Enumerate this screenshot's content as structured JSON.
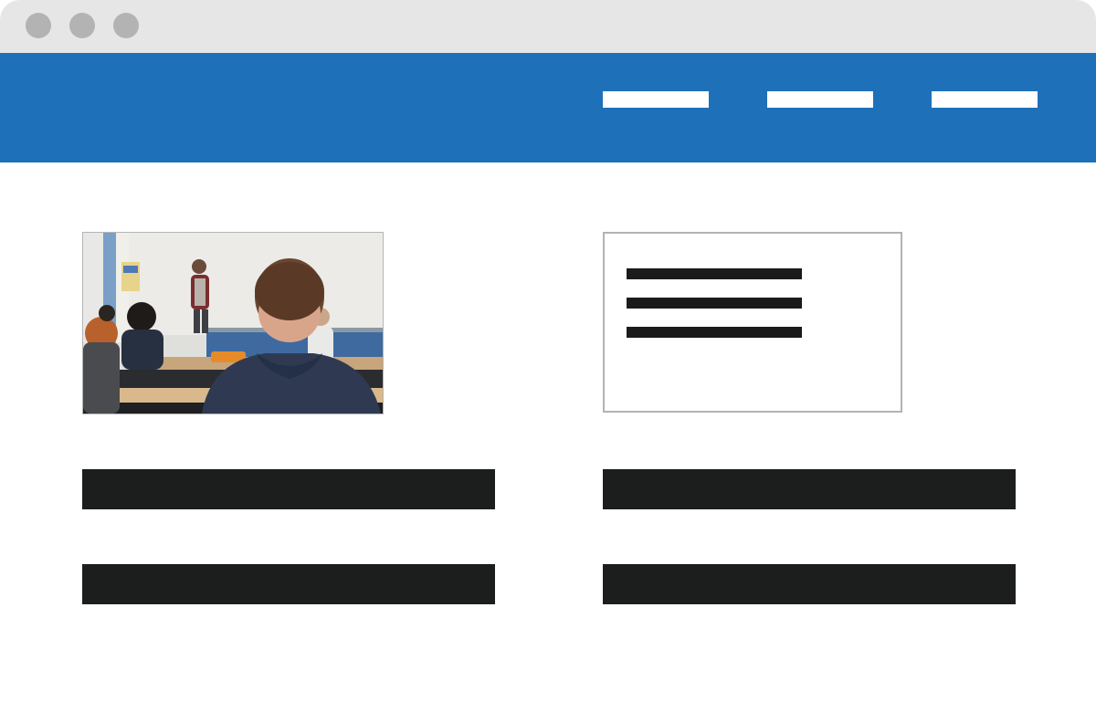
{
  "window": {
    "controls": [
      "window-dot",
      "window-dot",
      "window-dot"
    ]
  },
  "header": {
    "nav_links": [
      "",
      "",
      ""
    ],
    "color": "#1e70b9"
  },
  "image_card": {
    "icon": "classroom-photo"
  },
  "text_card": {
    "lines": 3
  },
  "content_bars": 4,
  "colors": {
    "titlebar": "#e6e6e6",
    "window_dot": "#b3b3b3",
    "header": "#1e70b9",
    "placeholder_dark": "#1c1d1d",
    "card_border": "#b3b3b3"
  }
}
